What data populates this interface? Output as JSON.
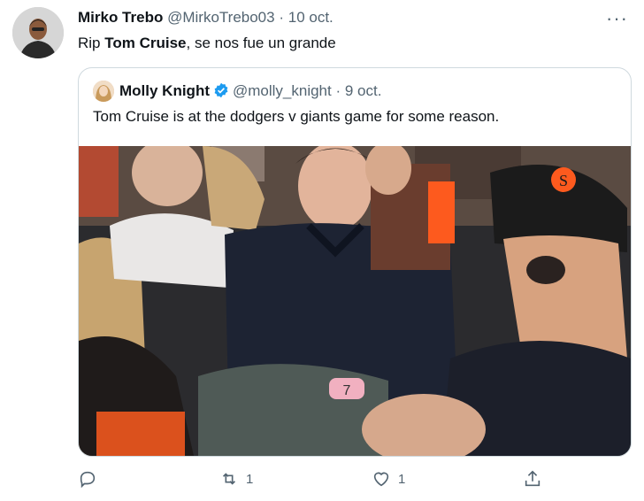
{
  "tweet": {
    "author_name": "Mirko Trebo",
    "author_handle": "@MirkoTrebo03",
    "separator": "·",
    "date": "10 oct.",
    "text_prefix": "Rip ",
    "text_bold": "Tom Cruise",
    "text_suffix": ", se nos fue un grande",
    "more_icon": "more-dots-icon"
  },
  "quoted": {
    "author_name": "Molly Knight",
    "author_handle": "@molly_knight",
    "separator": "·",
    "date": "9 oct.",
    "text": "Tom Cruise is at the dodgers v giants game for some reason.",
    "seat_number": "7",
    "verified_icon": "verified-badge-icon"
  },
  "actions": {
    "reply_icon": "reply-icon",
    "retweet_icon": "retweet-icon",
    "retweet_count": "1",
    "like_icon": "heart-icon",
    "like_count": "1",
    "share_icon": "share-icon"
  },
  "colors": {
    "verified": "#1d9bf0",
    "muted": "#536471",
    "border": "#cfd9de",
    "giants_orange": "#fd5a1e"
  }
}
